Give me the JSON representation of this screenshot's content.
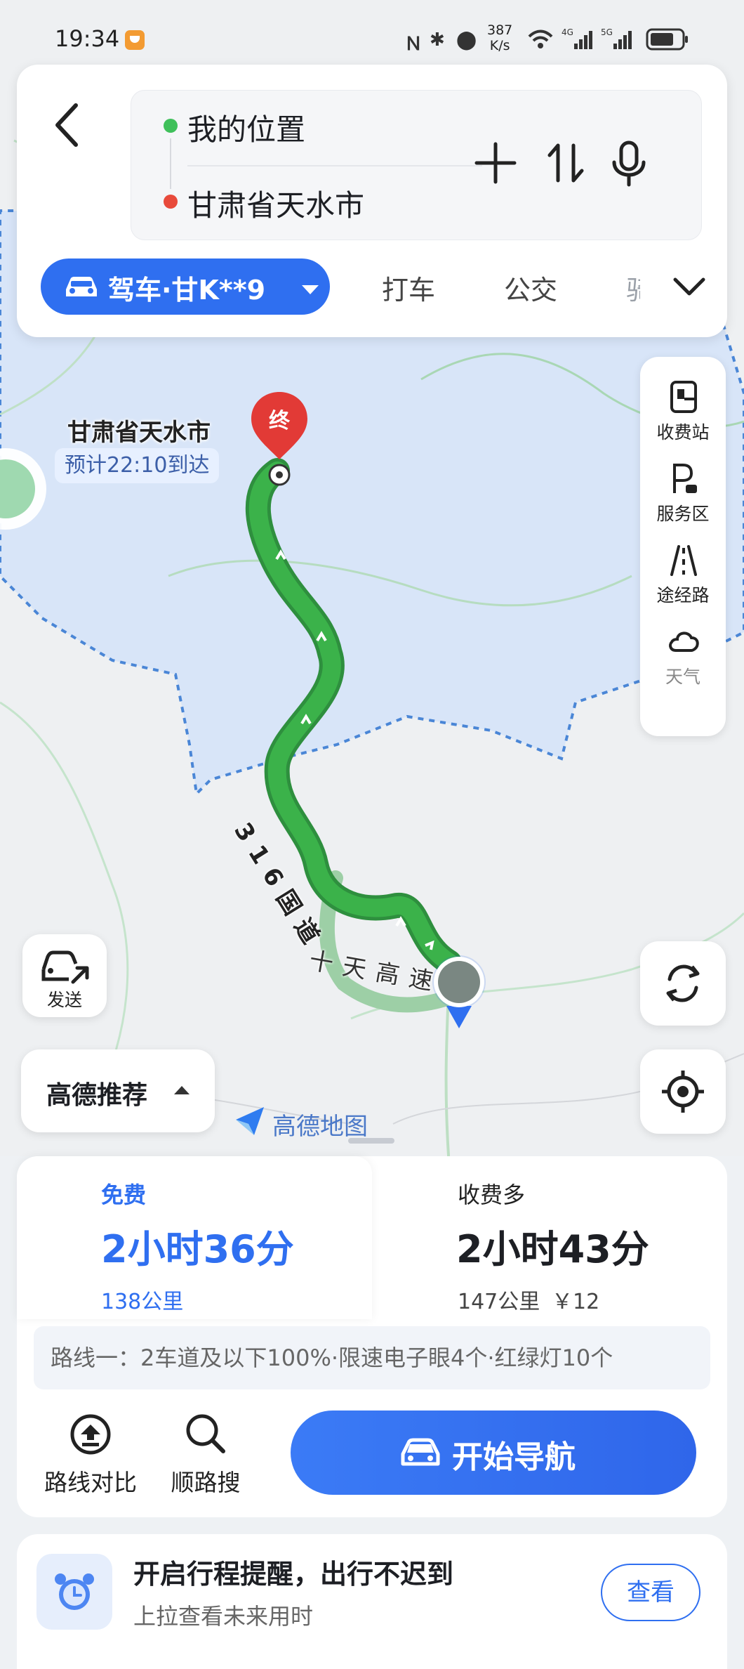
{
  "status_bar": {
    "time": "19:34",
    "net_speed_value": "387",
    "net_speed_unit": "K/s",
    "icons": [
      "nfc-icon",
      "bluetooth-icon",
      "location-icon",
      "wifi-icon",
      "signal-4g-icon",
      "signal-5g-icon",
      "battery-icon"
    ]
  },
  "search": {
    "origin": "我的位置",
    "destination": "甘肃省天水市"
  },
  "modes": {
    "active": "驾车·甘K**9",
    "tabs": [
      "打车",
      "公交",
      "骑"
    ]
  },
  "map": {
    "destination_label": "甘肃省天水市",
    "eta": "预计22:10到达",
    "end_marker": "终",
    "road_label_main": "316国道",
    "road_label_alt": "十天高速",
    "tools": [
      "收费站",
      "服务区",
      "途经路",
      "天气"
    ],
    "send_label": "发送",
    "recommend_label": "高德推荐",
    "logo_text": "高德地图"
  },
  "routes": [
    {
      "tag": "免费",
      "duration": "2小时36分",
      "distance": "138公里",
      "toll": ""
    },
    {
      "tag": "收费多",
      "duration": "2小时43分",
      "distance": "147公里",
      "toll": "￥12"
    }
  ],
  "route_desc": "路线一：2车道及以下100%·限速电子眼4个·红绿灯10个",
  "actions": {
    "compare": "路线对比",
    "along_search": "顺路搜",
    "navigate": "开始导航"
  },
  "reminder": {
    "title": "开启行程提醒，出行不迟到",
    "subtitle": "上拉查看未来用时",
    "button": "查看"
  },
  "colors": {
    "accent": "#2f6ff0",
    "route_green": "#3bb24a",
    "region_fill": "#d8e5f8"
  }
}
